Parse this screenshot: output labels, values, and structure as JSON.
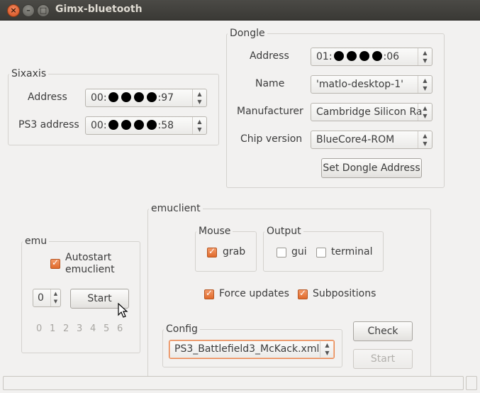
{
  "window": {
    "title": "Gimx-bluetooth"
  },
  "sixaxis": {
    "label": "Sixaxis",
    "address_label": "Address",
    "address_prefix": "00:",
    "address_suffix": ":97",
    "ps3_label": "PS3 address",
    "ps3_prefix": "00:",
    "ps3_suffix": ":58"
  },
  "dongle": {
    "label": "Dongle",
    "address_label": "Address",
    "address_prefix": "01:",
    "address_suffix": ":06",
    "name_label": "Name",
    "name_value": "'matlo-desktop-1'",
    "manufacturer_label": "Manufacturer",
    "manufacturer_value": "Cambridge Silicon Ra",
    "chip_label": "Chip version",
    "chip_value": "BlueCore4-ROM",
    "set_button": "Set Dongle Address"
  },
  "emu": {
    "label": "emu",
    "autostart_line1": "Autostart",
    "autostart_line2": "emuclient",
    "autostart_checked": true,
    "spin_value": "0",
    "start_button": "Start",
    "numbers": [
      "0",
      "1",
      "2",
      "3",
      "4",
      "5",
      "6"
    ]
  },
  "emuclient": {
    "label": "emuclient",
    "mouse": {
      "label": "Mouse",
      "grab_label": "grab",
      "grab_checked": true
    },
    "output": {
      "label": "Output",
      "gui_label": "gui",
      "gui_checked": false,
      "terminal_label": "terminal",
      "terminal_checked": false
    },
    "force_updates_label": "Force updates",
    "force_updates_checked": true,
    "subpositions_label": "Subpositions",
    "subpositions_checked": true,
    "config": {
      "label": "Config",
      "value": "PS3_Battlefield3_McKack.xml"
    },
    "check_button": "Check",
    "start_button": "Start"
  },
  "colors": {
    "accent": "#e06a2c",
    "titlebar": "#3f3e3a",
    "window_bg": "#f2f1f0"
  },
  "icons": [
    "close-icon",
    "minimize-icon",
    "maximize-icon",
    "mouse-cursor-icon"
  ]
}
